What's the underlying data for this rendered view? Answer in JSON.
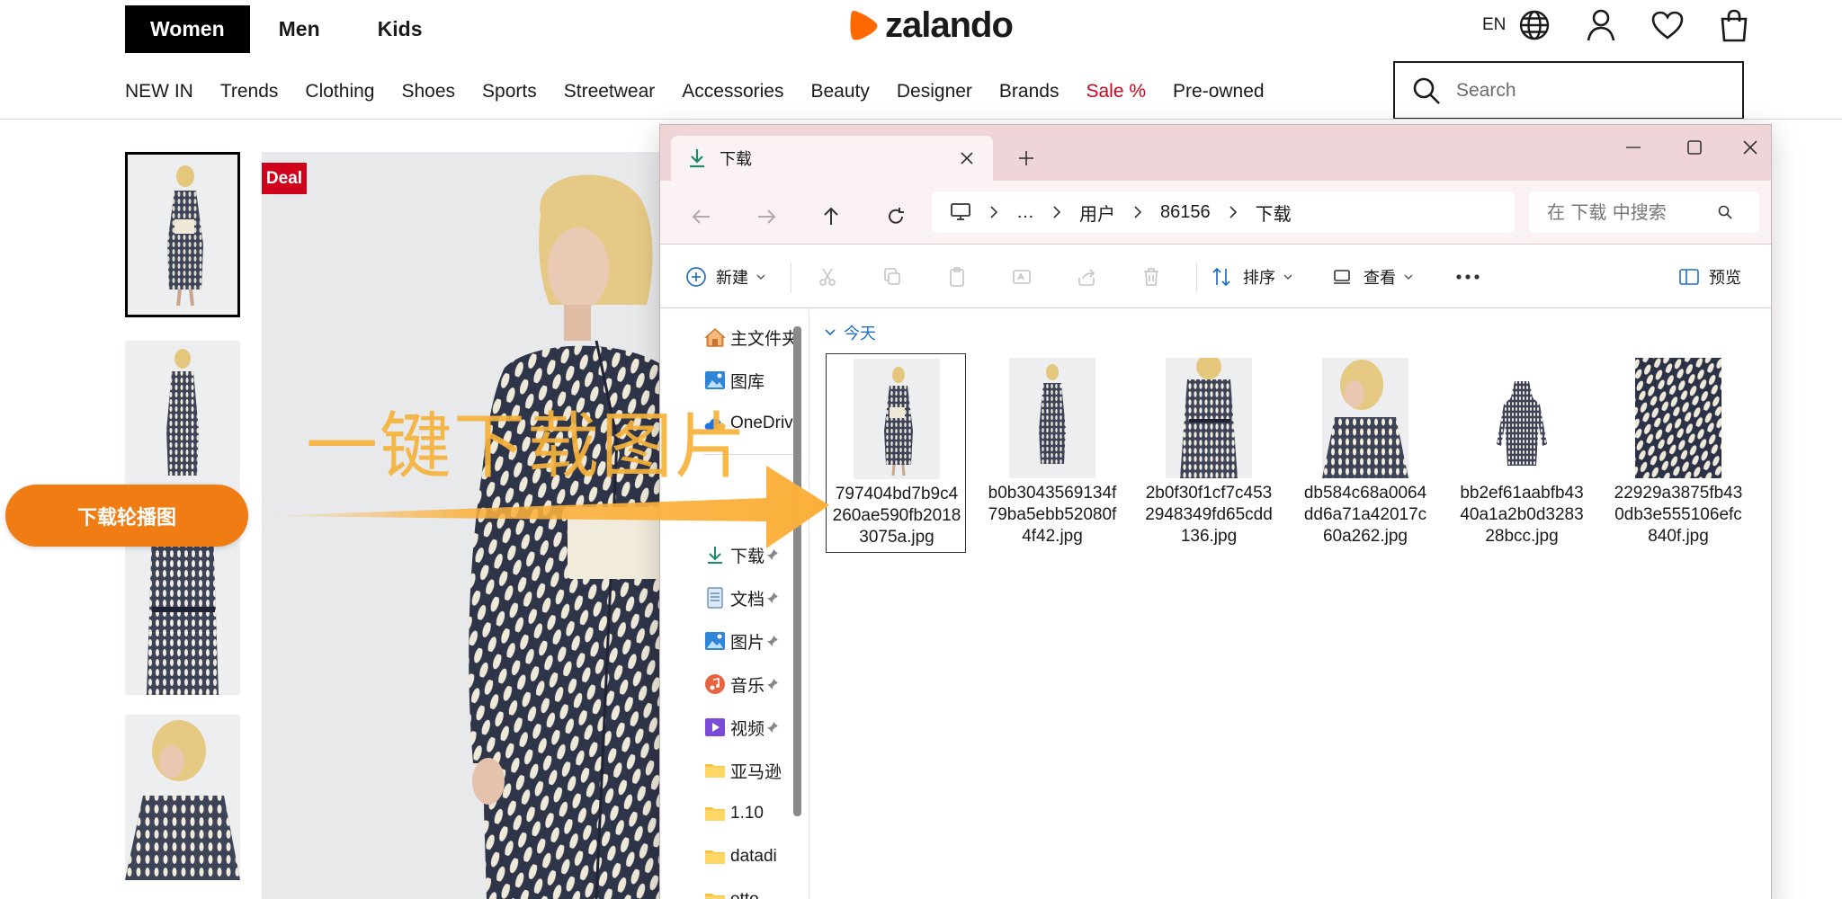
{
  "zalando": {
    "gender_tabs": [
      "Women",
      "Men",
      "Kids"
    ],
    "logo_text": "zalando",
    "language": "EN",
    "nav": [
      "NEW IN",
      "Trends",
      "Clothing",
      "Shoes",
      "Sports",
      "Streetwear",
      "Accessories",
      "Beauty",
      "Designer",
      "Brands",
      "Sale %",
      "Pre-owned"
    ],
    "search_placeholder": "Search",
    "deal_badge": "Deal",
    "accent_color": "#ff6900",
    "sale_color": "#d0021b"
  },
  "overlay": {
    "headline": "一键下载图片",
    "button_label": "下载轮播图",
    "arrow_color": "#fbb03b",
    "button_color": "#f07c14"
  },
  "explorer": {
    "tab_title": "下载",
    "breadcrumb": [
      "…",
      "用户",
      "86156",
      "下载"
    ],
    "search_placeholder": "在 下载 中搜索",
    "toolbar": {
      "new": "新建",
      "sort": "排序",
      "view": "查看",
      "preview": "预览"
    },
    "sidebar": [
      "主文件夹",
      "图库",
      "OneDrive",
      "下载",
      "文档",
      "图片",
      "音乐",
      "视频",
      "亚马逊",
      "1.10",
      "datadi",
      "otto"
    ],
    "group_label": "今天",
    "files": [
      {
        "name": "797404bd7b9c4260ae590fb20183075a.jpg",
        "pose": "front-full"
      },
      {
        "name": "b0b3043569134f79ba5ebb52080f4f42.jpg",
        "pose": "front-full"
      },
      {
        "name": "2b0f30f1cf7c4532948349fd65cdd136.jpg",
        "pose": "detail-waist"
      },
      {
        "name": "db584c68a0064dd6a71a42017c60a262.jpg",
        "pose": "profile"
      },
      {
        "name": "bb2ef61aabfb4340a1a2b0d328328bcc.jpg",
        "pose": "packshot"
      },
      {
        "name": "22929a3875fb430db3e555106efc840f.jpg",
        "pose": "fabric"
      }
    ]
  }
}
